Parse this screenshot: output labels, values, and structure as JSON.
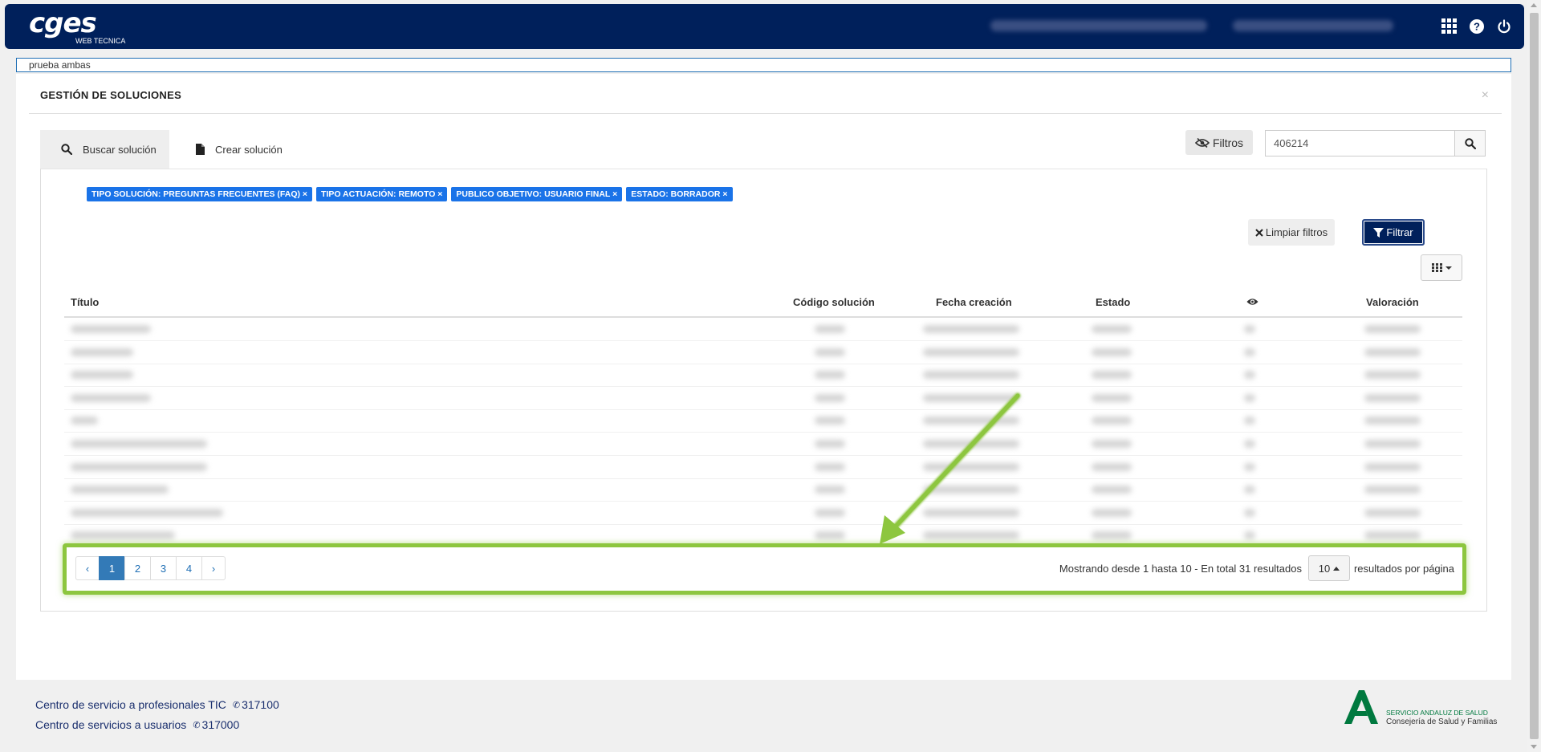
{
  "header": {
    "logo_main": "cges",
    "logo_sub": "WEB TECNICA",
    "icons": [
      "apps-grid-icon",
      "help-icon",
      "power-icon"
    ]
  },
  "open_tab": {
    "value": "prueba ambas"
  },
  "panel": {
    "title": "GESTIÓN DE SOLUCIONES",
    "close": "×",
    "tabs": [
      {
        "label": "Buscar solución",
        "icon": "search-icon"
      },
      {
        "label": "Crear solución",
        "icon": "document-icon"
      }
    ],
    "filters_button": "Filtros",
    "search_value": "406214"
  },
  "active_filters": [
    "TIPO SOLUCIÓN: PREGUNTAS FRECUENTES (FAQ) ×",
    "TIPO ACTUACIÓN: REMOTO ×",
    "PUBLICO OBJETIVO: USUARIO FINAL ×",
    "ESTADO: BORRADOR ×"
  ],
  "actions": {
    "clear_filters": "Limpiar filtros",
    "apply_filters": "Filtrar"
  },
  "table": {
    "columns": [
      "Título",
      "Código solución",
      "Fecha creación",
      "Estado",
      "Valoración"
    ],
    "visible_column_icon": "eye-icon",
    "row_count": 10
  },
  "pagination": {
    "prev": "‹",
    "pages": [
      "1",
      "2",
      "3",
      "4"
    ],
    "active_page": "1",
    "next": "›",
    "info": "Mostrando desde 1 hasta 10 - En total 31 resultados",
    "per_page": "10",
    "per_page_label": "resultados por página"
  },
  "footer": {
    "line1_text": "Centro de servicio a profesionales TIC",
    "line1_phone": "317100",
    "line2_text": "Centro de servicios a usuarios",
    "line2_phone": "317000",
    "logo_line1": "SERVICIO ANDALUZ DE SALUD",
    "logo_line2": "Consejería de Salud y Familias"
  },
  "colors": {
    "header_bg": "#00205b",
    "chip_bg": "#1a73e8",
    "highlight": "#8dc63f",
    "active_page": "#337ab7"
  }
}
